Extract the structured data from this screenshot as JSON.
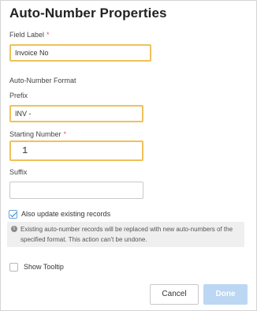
{
  "dialog": {
    "title": "Auto-Number Properties"
  },
  "field_label": {
    "label": "Field Label",
    "required_mark": "*",
    "value": "Invoice No"
  },
  "format_section": {
    "heading": "Auto-Number Format"
  },
  "prefix": {
    "label": "Prefix",
    "value": "INV -"
  },
  "starting_number": {
    "label": "Starting Number",
    "required_mark": "*",
    "value": "1"
  },
  "suffix": {
    "label": "Suffix",
    "value": ""
  },
  "update_existing": {
    "label": "Also update existing records",
    "checked": true
  },
  "info": {
    "icon": "info-icon",
    "text": "Existing auto-number records will be replaced with new auto-numbers of the specified format. This action can't be undone."
  },
  "show_tooltip": {
    "label": "Show Tooltip",
    "checked": false
  },
  "footer": {
    "cancel_label": "Cancel",
    "done_label": "Done"
  },
  "colors": {
    "highlight_border": "#f0c15b",
    "required": "#e05b5b",
    "done_button": "#bcd7f3",
    "checkbox_check": "#2f7fd3"
  }
}
